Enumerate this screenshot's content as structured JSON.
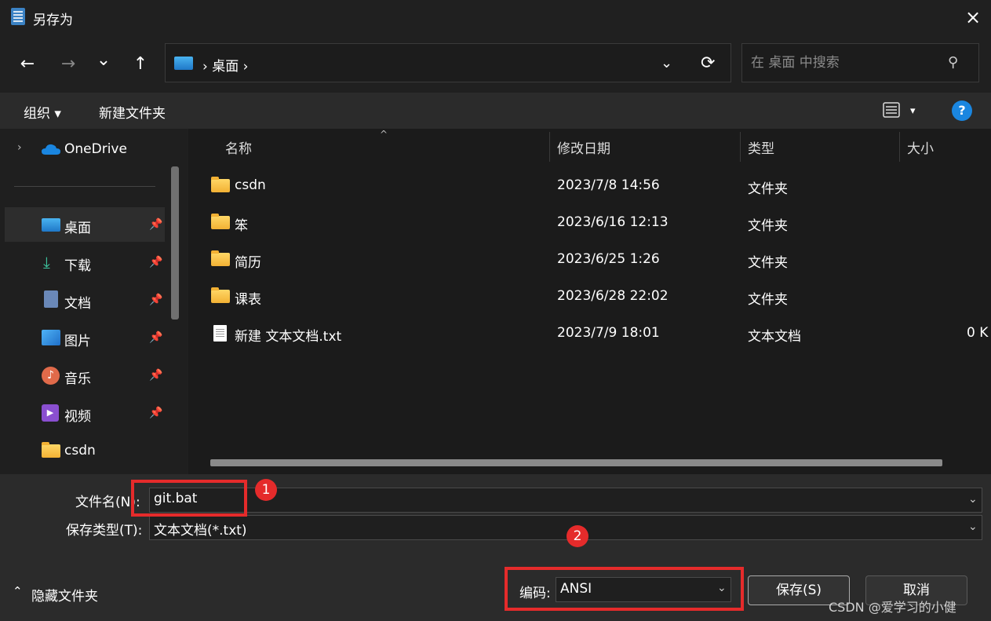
{
  "window": {
    "title": "另存为",
    "close_icon": "×"
  },
  "nav": {
    "back_icon": "←",
    "forward_icon": "→",
    "recent_icon": "⌄",
    "up_icon": "↑",
    "breadcrumb": "› 桌面 ›",
    "dropdown_icon": "⌄",
    "refresh_icon": "⟳"
  },
  "search": {
    "placeholder": "在 桌面 中搜索",
    "icon": "⚲"
  },
  "toolbar": {
    "organize": "组织 ▾",
    "new_folder": "新建文件夹",
    "view_chevron": "▾",
    "help": "?"
  },
  "sidebar": {
    "onedrive": "OneDrive",
    "items": [
      {
        "label": "桌面",
        "icon": "desktop-icon",
        "pinned": true
      },
      {
        "label": "下载",
        "icon": "download-icon",
        "pinned": true
      },
      {
        "label": "文档",
        "icon": "document-icon",
        "pinned": true
      },
      {
        "label": "图片",
        "icon": "pictures-icon",
        "pinned": true
      },
      {
        "label": "音乐",
        "icon": "music-icon",
        "pinned": true
      },
      {
        "label": "视频",
        "icon": "video-icon",
        "pinned": true
      },
      {
        "label": "csdn",
        "icon": "folder-icon",
        "pinned": false
      }
    ]
  },
  "columns": {
    "name": "名称",
    "modified": "修改日期",
    "type": "类型",
    "size": "大小"
  },
  "files": [
    {
      "name": "csdn",
      "modified": "2023/7/8 14:56",
      "type": "文件夹",
      "size": ""
    },
    {
      "name": "笨",
      "modified": "2023/6/16 12:13",
      "type": "文件夹",
      "size": ""
    },
    {
      "name": "简历",
      "modified": "2023/6/25 1:26",
      "type": "文件夹",
      "size": ""
    },
    {
      "name": "课表",
      "modified": "2023/6/28 22:02",
      "type": "文件夹",
      "size": ""
    },
    {
      "name": "新建 文本文档.txt",
      "modified": "2023/7/9 18:01",
      "type": "文本文档",
      "size": "0 K"
    }
  ],
  "form": {
    "filename_label": "文件名(N):",
    "filename_value": "git.bat",
    "filetype_label": "保存类型(T):",
    "filetype_value": "文本文档(*.txt)",
    "encoding_label": "编码:",
    "encoding_value": "ANSI",
    "hide_folders": "隐藏文件夹",
    "save": "保存(S)",
    "cancel": "取消"
  },
  "annotations": {
    "badge1": "1",
    "badge2": "2"
  },
  "watermark": "CSDN @爱学习的小健"
}
